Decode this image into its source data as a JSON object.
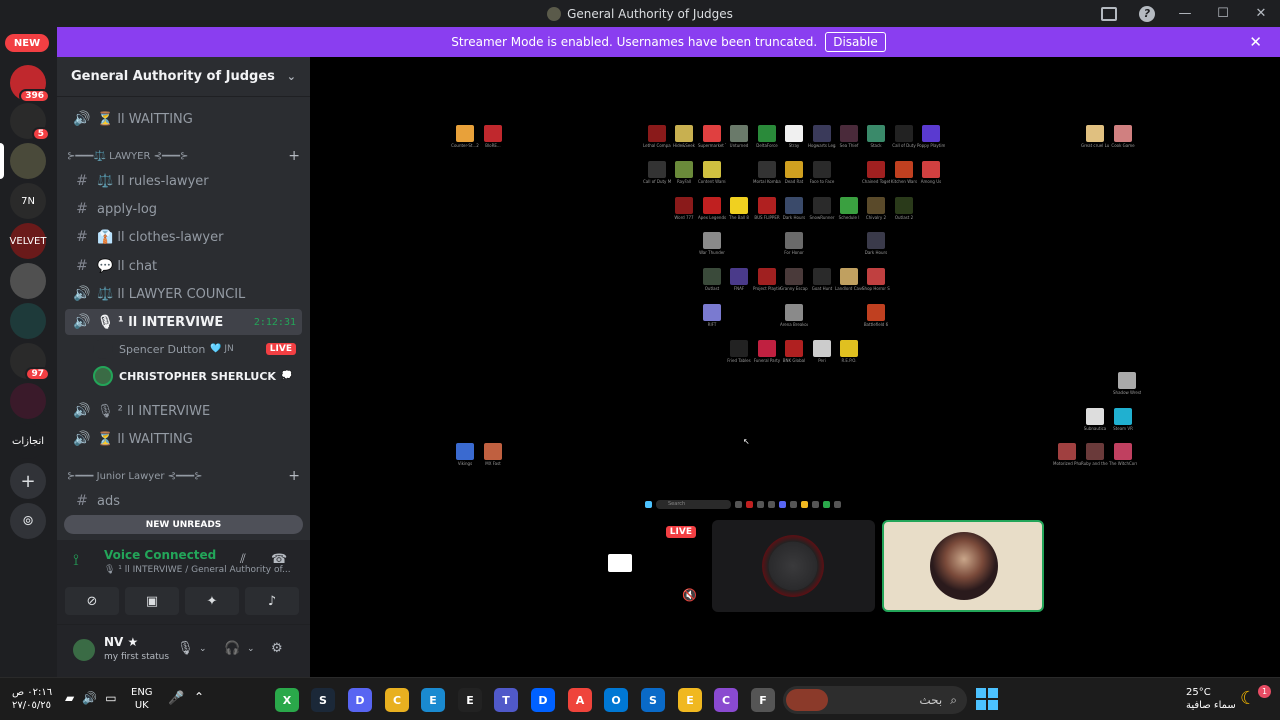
{
  "window": {
    "title": "General Authority of Judges"
  },
  "banner": {
    "text": "Streamer Mode is enabled. Usernames have been truncated.",
    "button": "Disable"
  },
  "rail": {
    "new_badge": "NEW",
    "servers": [
      {
        "name": "server-1",
        "badge": "396",
        "color": "#c0282d"
      },
      {
        "name": "server-2",
        "badge": "5",
        "color": "#2a2a2a"
      },
      {
        "name": "server-3",
        "badge": "",
        "color": "#4a4a3a"
      },
      {
        "name": "server-4",
        "label": "7N",
        "badge": "",
        "color": "#2a2a2a"
      },
      {
        "name": "server-5",
        "label": "VELVET",
        "badge": "",
        "color": "#6a1a1a"
      },
      {
        "name": "server-6",
        "badge": "",
        "color": "#505050"
      },
      {
        "name": "server-7",
        "badge": "",
        "color": "#1e3a3a"
      },
      {
        "name": "server-8",
        "badge": "97",
        "color": "#2a2a2a"
      },
      {
        "name": "server-9",
        "badge": "",
        "color": "#3a1a2a"
      },
      {
        "name": "server-10",
        "label": "انجازات",
        "badge": "",
        "color": "#1e1f22"
      }
    ]
  },
  "sidebar": {
    "server_name": "General Authority of Judges",
    "channels": [
      {
        "icon": "🔊",
        "label": "⏳ اا WAITTING"
      },
      {
        "category": "⊱━━━⚖️ LAWYER ⊰━━━⊱"
      },
      {
        "icon": "#",
        "label": "⚖️ اا rules-lawyer"
      },
      {
        "icon": "#",
        "label": "apply-log"
      },
      {
        "icon": "#",
        "label": "👔 اا clothes-lawyer"
      },
      {
        "icon": "#",
        "label": "💬 اا chat"
      },
      {
        "icon": "🔊",
        "label": "⚖️ اا LAWYER COUNCIL"
      },
      {
        "icon": "🔊",
        "label": "🎙 اا ¹ INTERVIWE",
        "timer": "2:12:31",
        "active": true
      },
      {
        "icon": "🔊",
        "label": "🎙 اا ² INTERVIWE"
      },
      {
        "icon": "🔊",
        "label": "⏳ اا WAITTING"
      },
      {
        "category": "⊱━━━ Junior Lawyer ⊰━━━⊱"
      },
      {
        "icon": "#",
        "label": "ads"
      }
    ],
    "voice_users": [
      {
        "name": "Spencer Dutton",
        "tag": "🩵 JN",
        "live": "LIVE"
      },
      {
        "name": "CHRISTOPHER SHERLUCK",
        "tag": "💭"
      }
    ],
    "new_unreads": "NEW UNREADS"
  },
  "voice_panel": {
    "status": "Voice Connected",
    "channel": "🎙 اا ¹ INTERVIWE / General Authority of..."
  },
  "user_panel": {
    "name": "NV ★",
    "status": "my first status"
  },
  "stream": {
    "live_label": "LIVE",
    "mini_search": "Search",
    "desktop_icons": [
      {
        "label": "Counter-St...2",
        "color": "#e8a13a"
      },
      {
        "label": "BloRE...",
        "color": "#c0282d"
      },
      {
        "label": "Lethal Company",
        "color": "#8a1a1a"
      },
      {
        "label": "Hide&Seek",
        "color": "#c8b050"
      },
      {
        "label": "Supermarket Together",
        "color": "#e04040"
      },
      {
        "label": "Unturned",
        "color": "#6a7a6a"
      },
      {
        "label": "DeltaForce",
        "color": "#2a8a3a"
      },
      {
        "label": "Stray",
        "color": "#f0f0f0"
      },
      {
        "label": "Hogwarts Legacy",
        "color": "#3a3a5a"
      },
      {
        "label": "Sea Thief",
        "color": "#4a2a3a"
      },
      {
        "label": "Stack",
        "color": "#3a8a6a"
      },
      {
        "label": "Call of Duty",
        "color": "#222"
      },
      {
        "label": "Poppy Playtime",
        "color": "#5a3ad0"
      },
      {
        "label": "Call of Duty Modern",
        "color": "#333"
      },
      {
        "label": "RayFall",
        "color": "#6a8a3a"
      },
      {
        "label": "Content Warning",
        "color": "#d0c040"
      },
      {
        "label": "Mortal Kombat",
        "color": "#333"
      },
      {
        "label": "Dead Rat",
        "color": "#d0a020"
      },
      {
        "label": "Face to Face",
        "color": "#2a2a2a"
      },
      {
        "label": "Chained Together",
        "color": "#a02020"
      },
      {
        "label": "Kitchen Wars",
        "color": "#c04020"
      },
      {
        "label": "Among Us",
        "color": "#d04040"
      },
      {
        "label": "Word 777",
        "color": "#8a1a1a"
      },
      {
        "label": "Apex Legends",
        "color": "#c02020"
      },
      {
        "label": "The Ball 8",
        "color": "#f0d020"
      },
      {
        "label": "BUS FLIPPER",
        "color": "#b02020"
      },
      {
        "label": "Dark Hours",
        "color": "#3a4a6a"
      },
      {
        "label": "SnowRunner",
        "color": "#2a2a2a"
      },
      {
        "label": "Schedule I",
        "color": "#3aa040"
      },
      {
        "label": "Chivalry 2",
        "color": "#5a4a2a"
      },
      {
        "label": "Outlast 2",
        "color": "#2a3a1a"
      },
      {
        "label": "War Thunder",
        "color": "#8a8a8a"
      },
      {
        "label": "For Honor",
        "color": "#6a6a6a"
      },
      {
        "label": "Dark Hours",
        "color": "#3a3a4a"
      },
      {
        "label": "Outlast",
        "color": "#3a4a3a"
      },
      {
        "label": "FNAF",
        "color": "#4a3a8a"
      },
      {
        "label": "Project Playtime",
        "color": "#a02020"
      },
      {
        "label": "Granny Escape",
        "color": "#4a3a3a"
      },
      {
        "label": "Goat Hunt",
        "color": "#2a2a2a"
      },
      {
        "label": "Landlord Cave",
        "color": "#c0a060"
      },
      {
        "label": "Shop Horror Simulator",
        "color": "#c04040"
      },
      {
        "label": "RIFT",
        "color": "#7a7ad0"
      },
      {
        "label": "Arena Breakout",
        "color": "#8a8a8a"
      },
      {
        "label": "Battlefield 6",
        "color": "#c04020"
      },
      {
        "label": "Fried Tables",
        "color": "#222"
      },
      {
        "label": "Funeral Party",
        "color": "#c02040"
      },
      {
        "label": "BNK Global",
        "color": "#b02020"
      },
      {
        "label": "Peri",
        "color": "#ccc"
      },
      {
        "label": "R.E.P.O.",
        "color": "#e0c020"
      },
      {
        "label": "Great cruel Luck",
        "color": "#e0c080"
      },
      {
        "label": "Cook Game",
        "color": "#d08080"
      },
      {
        "label": "Shadow Wrestler",
        "color": "#aaa"
      },
      {
        "label": "Subnautica",
        "color": "#ddd"
      },
      {
        "label": "Steam VR",
        "color": "#20b0d0"
      },
      {
        "label": "Vikings",
        "color": "#3a6ad0"
      },
      {
        "label": "MX Fast",
        "color": "#c06040"
      },
      {
        "label": "Motorized Phantoms",
        "color": "#a04040"
      },
      {
        "label": "Ruby and the Lost Cavern",
        "color": "#6a3a3a"
      },
      {
        "label": "The WitchCorner",
        "color": "#c04060"
      }
    ]
  },
  "taskbar": {
    "time": "٠٢:١٦ ص",
    "date": "٢٧/٠٥/٢٥",
    "lang_top": "ENG",
    "lang_bottom": "UK",
    "search": "بحث",
    "temp": "25°C",
    "weather": "سماء صافية",
    "weather_badge": "1",
    "apps": [
      {
        "name": "xbox",
        "color": "#2aa84a"
      },
      {
        "name": "steam",
        "color": "#1b2838"
      },
      {
        "name": "discord",
        "color": "#5865f2"
      },
      {
        "name": "chrome",
        "color": "#e8b020"
      },
      {
        "name": "edge",
        "color": "#1a8ad0"
      },
      {
        "name": "epic",
        "color": "#222"
      },
      {
        "name": "teams",
        "color": "#5059c9"
      },
      {
        "name": "dropbox",
        "color": "#0061ff"
      },
      {
        "name": "anydesk",
        "color": "#ef443b"
      },
      {
        "name": "outlook",
        "color": "#0078d4"
      },
      {
        "name": "store",
        "color": "#0a6ac8"
      },
      {
        "name": "explorer",
        "color": "#f0b820"
      },
      {
        "name": "copilot",
        "color": "#8a4ad0"
      },
      {
        "name": "files",
        "color": "#555"
      }
    ]
  }
}
